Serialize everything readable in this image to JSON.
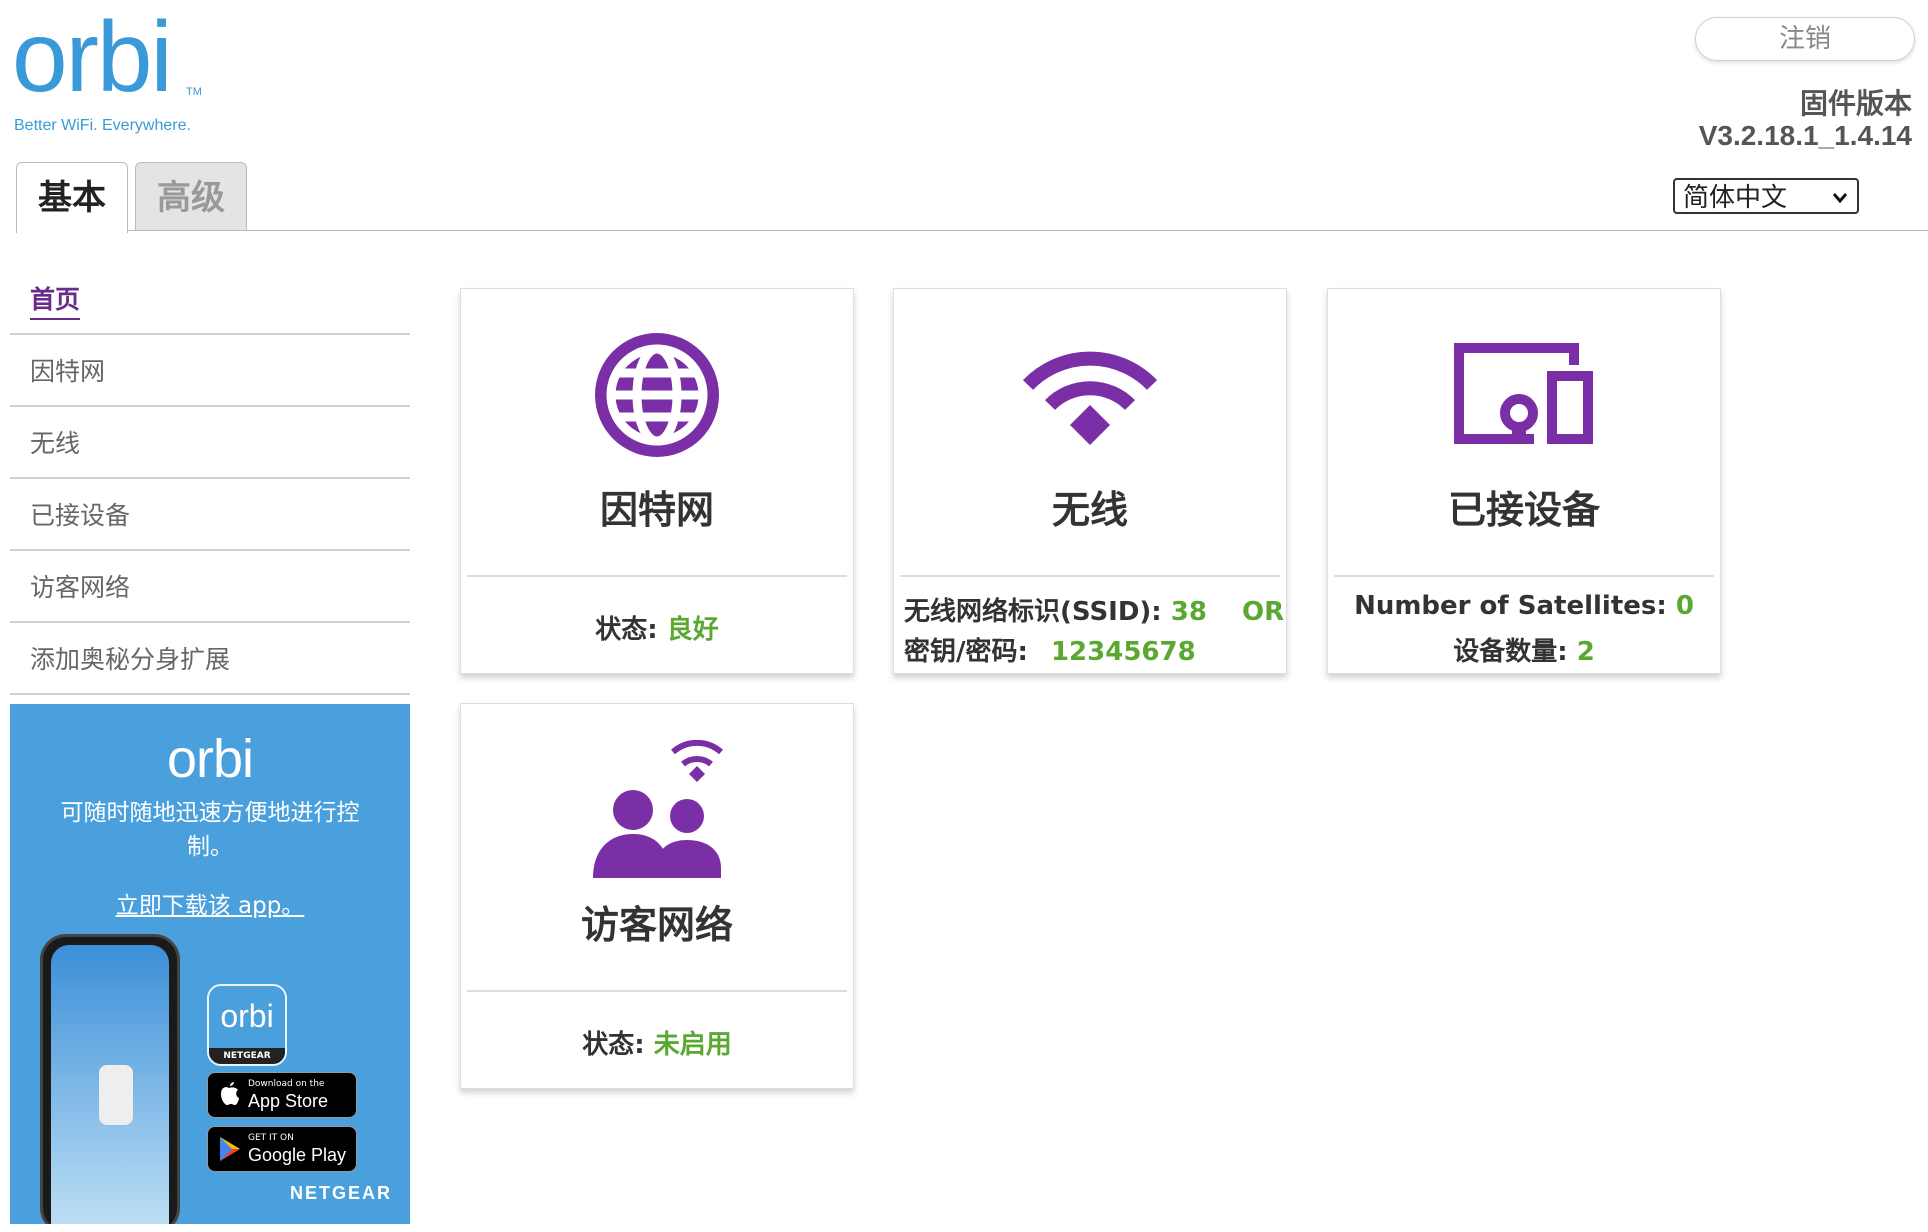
{
  "header": {
    "logo_text": "orbi",
    "logo_tm": "TM",
    "tagline": "Better WiFi. Everywhere.",
    "logout_label": "注销",
    "firmware_label": "固件版本",
    "firmware_version": "V3.2.18.1_1.4.14",
    "language_selected": "简体中文"
  },
  "tabs": [
    {
      "label": "基本",
      "active": true
    },
    {
      "label": "高级",
      "active": false
    }
  ],
  "sidebar": {
    "items": [
      {
        "label": "首页",
        "active": true
      },
      {
        "label": "因特网",
        "active": false
      },
      {
        "label": "无线",
        "active": false
      },
      {
        "label": "已接设备",
        "active": false
      },
      {
        "label": "访客网络",
        "active": false
      },
      {
        "label": "添加奥秘分身扩展",
        "active": false
      }
    ]
  },
  "promo": {
    "logo_text": "orbi",
    "text": "可随时随地迅速方便地进行控制。",
    "link": "立即下载该 app。",
    "app_icon_word": "orbi",
    "app_icon_brand": "NETGEAR",
    "appstore_small": "Download on the",
    "appstore_big": "App Store",
    "googleplay_small": "GET IT ON",
    "googleplay_big": "Google Play",
    "brand": "NETGEAR"
  },
  "cards": {
    "internet": {
      "title": "因特网",
      "status_label": "状态:",
      "status_value": "良好",
      "icon": "globe-icon"
    },
    "wireless": {
      "title": "无线",
      "ssid_label": "无线网络标识(SSID):",
      "ssid_value": "38",
      "ssid_suffix": "OR",
      "key_label": "密钥/密码:",
      "key_value": "12345678",
      "icon": "wifi-icon"
    },
    "devices": {
      "title": "已接设备",
      "satellites_label": "Number of Satellites:",
      "satellites_value": "0",
      "count_label": "设备数量:",
      "count_value": "2",
      "icon": "devices-icon"
    },
    "guest": {
      "title": "访客网络",
      "status_label": "状态:",
      "status_value": "未启用",
      "icon": "guest-network-icon"
    }
  },
  "colors": {
    "brand_blue": "#3a9ad9",
    "icon_purple": "#7b2fa6",
    "status_green": "#5aa832",
    "promo_blue": "#4aa0dc"
  }
}
